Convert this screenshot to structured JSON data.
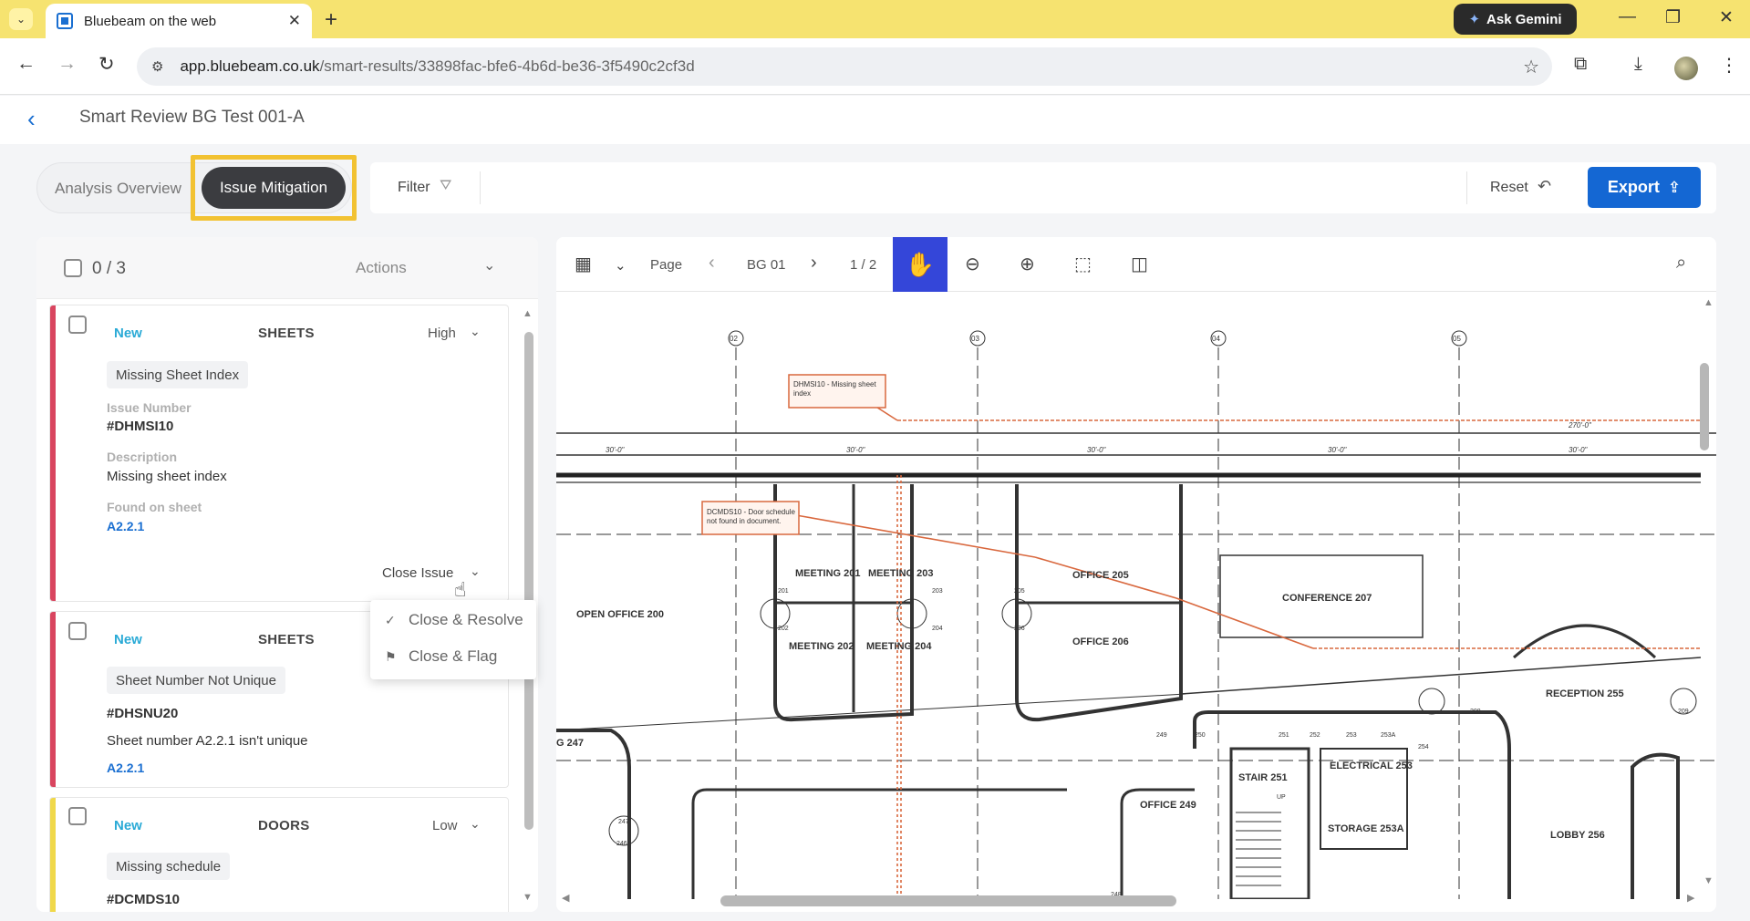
{
  "browser": {
    "tab_title": "Bluebeam on the web",
    "url_host": "app.bluebeam.co.uk",
    "url_path": "/smart-results/33898fac-bfe6-4b6d-be36-3f5490c2cf3d",
    "gemini_label": "Ask Gemini"
  },
  "header": {
    "title": "Smart Review BG Test 001-A"
  },
  "toolbar": {
    "tabs": [
      "Analysis Overview",
      "Issue Mitigation"
    ],
    "active_tab": "Issue Mitigation",
    "filter_label": "Filter",
    "reset_label": "Reset",
    "export_label": "Export"
  },
  "issues_panel": {
    "count": "0 / 3",
    "actions_label": "Actions",
    "cards": [
      {
        "status": "New",
        "category": "SHEETS",
        "priority": "High",
        "title": "Missing Sheet Index",
        "issue_number_label": "Issue Number",
        "issue_number": "#DHMSI10",
        "description_label": "Description",
        "description": "Missing sheet index",
        "found_label": "Found on sheet",
        "sheet": "A2.2.1",
        "close_label": "Close Issue",
        "accent": "#d9455f"
      },
      {
        "status": "New",
        "category": "SHEETS",
        "title": "Sheet Number Not Unique",
        "issue_number": "#DHSNU20",
        "description": "Sheet number A2.2.1 isn't unique",
        "sheet": "A2.2.1",
        "accent": "#d9455f"
      },
      {
        "status": "New",
        "category": "DOORS",
        "priority": "Low",
        "title": "Missing schedule",
        "issue_number": "#DCMDS10",
        "accent": "#f0d84a"
      }
    ],
    "close_menu": [
      "Close & Resolve",
      "Close & Flag"
    ]
  },
  "viewer": {
    "page_label": "Page",
    "page_name": "BG 01",
    "page_count": "1 / 2",
    "drawing": {
      "grid_bubbles": [
        "02",
        "03",
        "04",
        "05"
      ],
      "dims": [
        "30'-0\"",
        "30'-0\"",
        "30'-0\"",
        "30'-0\"",
        "30'-0\"",
        "270'-0\""
      ],
      "rooms": [
        "MEETING 201",
        "MEETING 203",
        "OFFICE 205",
        "CONFERENCE 207",
        "OPEN OFFICE 200",
        "MEETING 202",
        "MEETING 204",
        "OFFICE 206",
        "RECEPTION 255",
        "G 247",
        "STAIR 251",
        "ELECTRICAL 253",
        "OFFICE 249",
        "STORAGE 253A",
        "LOBBY 256",
        "UP"
      ],
      "door_tags": [
        "201",
        "202",
        "203",
        "204",
        "205",
        "206",
        "208",
        "209",
        "248",
        "249",
        "250",
        "251",
        "252",
        "253",
        "253A",
        "254",
        "247",
        "246A"
      ],
      "markup_1": [
        "DHMSI10 - Missing sheet",
        "index"
      ],
      "markup_2": [
        "DCMDS10 - Door schedule",
        "not found in document."
      ]
    }
  }
}
